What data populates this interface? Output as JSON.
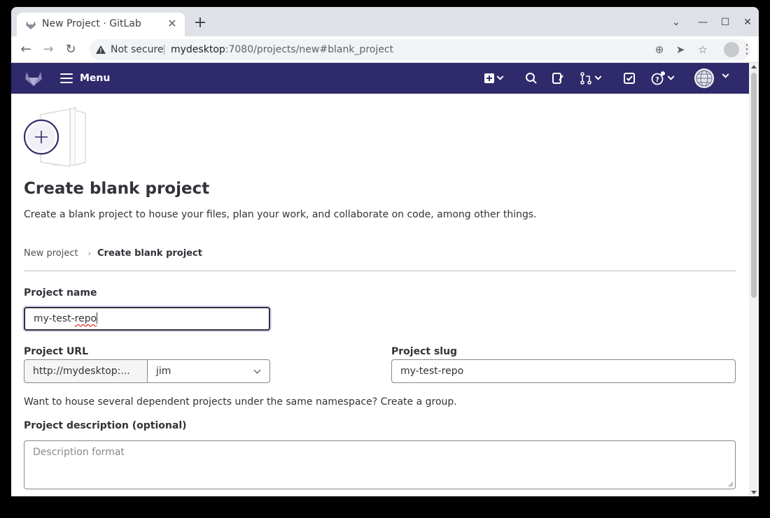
{
  "browser": {
    "tab_title": "New Project · GitLab",
    "not_secure": "Not secure",
    "url_host": "mydesktop",
    "url_rest": ":7080/projects/new#blank_project"
  },
  "gitlab": {
    "menu_label": "Menu",
    "brand_color": "#2f2a6b"
  },
  "page": {
    "title": "Create blank project",
    "description": "Create a blank project to house your files, plan your work, and collaborate on code, among other things.",
    "breadcrumb": [
      "New project",
      "Create blank project"
    ]
  },
  "form": {
    "project_name_label": "Project name",
    "project_name_value_prefix": "my-test-",
    "project_name_value_misspelled": "repo",
    "project_url_label": "Project URL",
    "project_url_prefix": "http://mydesktop:...",
    "namespace_value": "jim",
    "project_slug_label": "Project slug",
    "project_slug_value": "my-test-repo",
    "help_text": "Want to house several dependent projects under the same namespace? Create a group.",
    "description_label": "Project description (optional)",
    "description_placeholder": "Description format"
  }
}
